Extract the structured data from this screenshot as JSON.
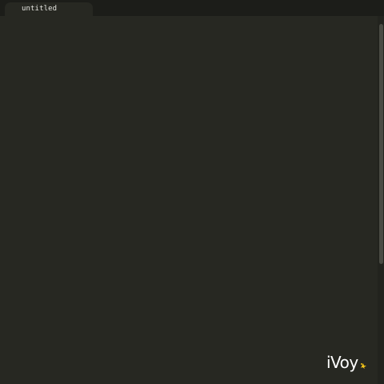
{
  "editor": {
    "tabs": [
      {
        "label": "untitled",
        "active": true
      }
    ],
    "content": ""
  },
  "watermark": {
    "text": "iVoy",
    "mark_icon": "yellow-sparkle-icon"
  },
  "colors": {
    "editor_background": "#272822",
    "tabbar_background": "#1c1d19",
    "tab_text": "#e6e6e1",
    "scrollbar_thumb": "#4a4b44",
    "logo_text": "#ffffff",
    "logo_mark": "#f5c518"
  }
}
